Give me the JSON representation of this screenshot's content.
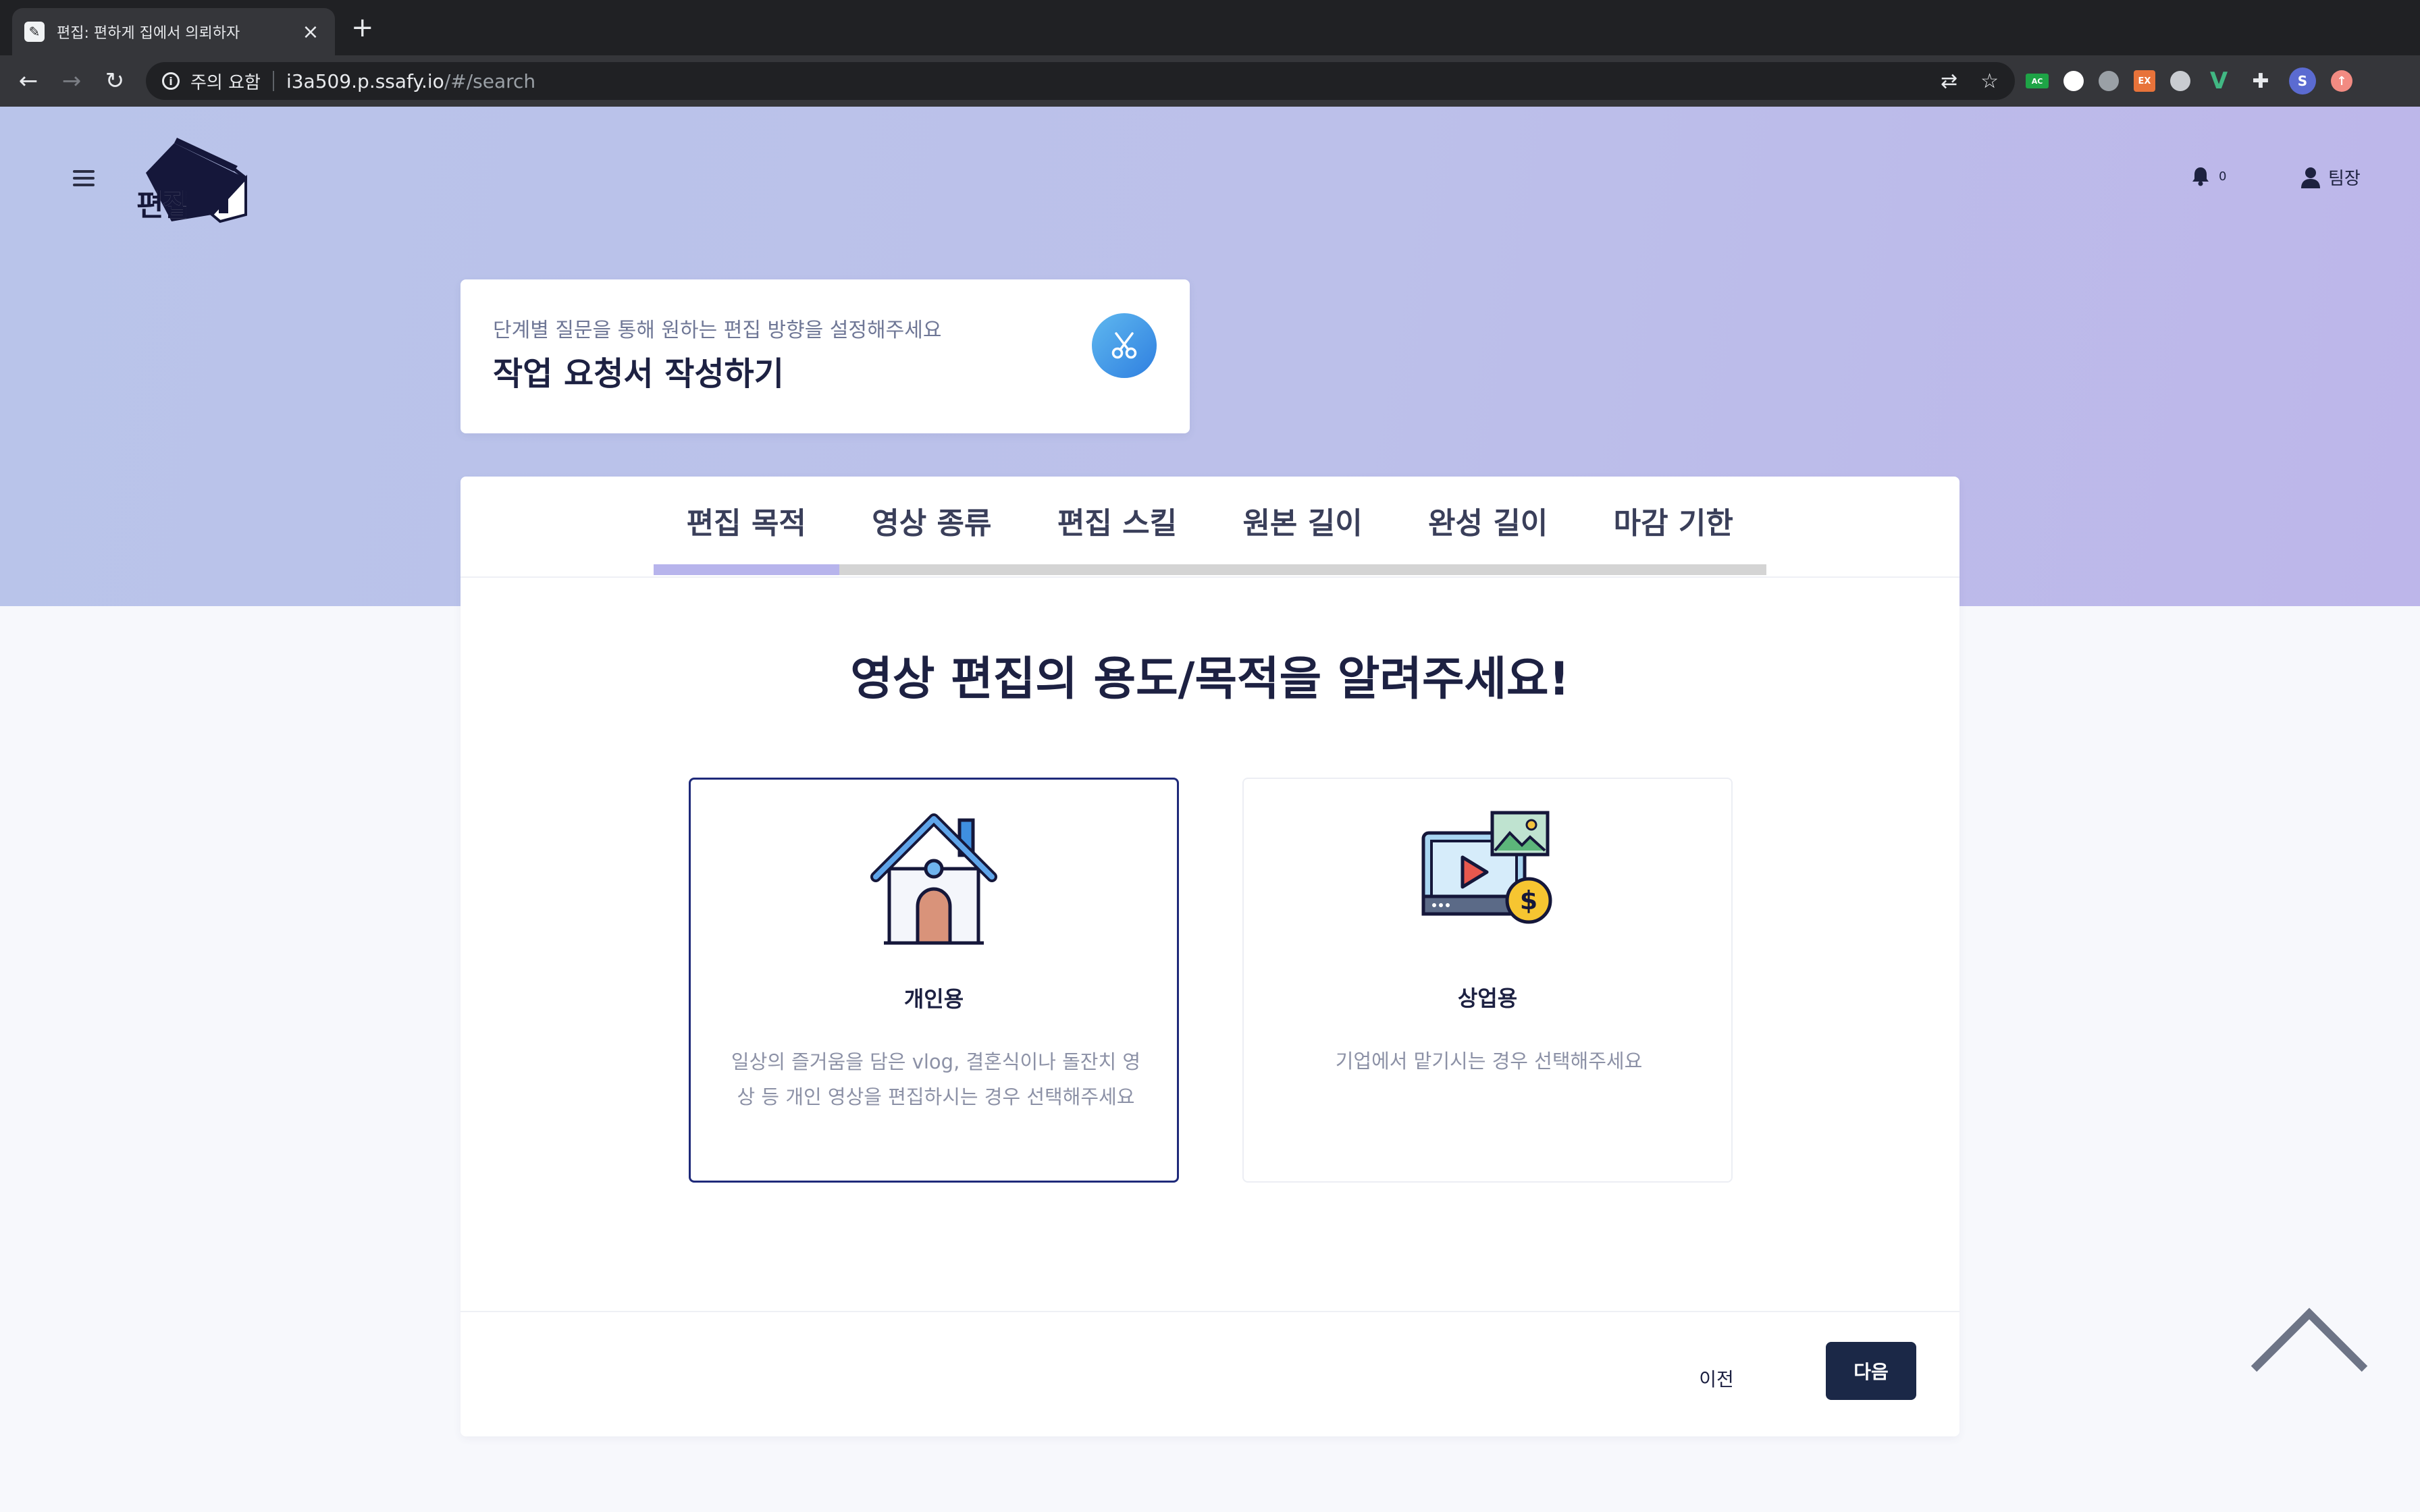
{
  "browser": {
    "tab_title": "편집: 편하게 집에서 의뢰하자",
    "security_text": "주의 요함",
    "url_host": "i3a509.p.ssafy.io",
    "url_path": "/#/search"
  },
  "nav": {
    "logo_text": "편집",
    "notification_count": "0",
    "user_name": "팀장"
  },
  "header_card": {
    "subtitle": "단계별 질문을 통해 원하는 편집 방향을 설정해주세요",
    "title": "작업 요청서 작성하기"
  },
  "steps": {
    "items": [
      {
        "label": "편집 목적"
      },
      {
        "label": "영상 종류"
      },
      {
        "label": "편집 스킬"
      },
      {
        "label": "원본 길이"
      },
      {
        "label": "완성 길이"
      },
      {
        "label": "마감 기한"
      }
    ],
    "current_step": 1,
    "progress_fraction": 0.1667
  },
  "question": "영상 편집의 용도/목적을 알려주세요!",
  "options": [
    {
      "title": "개인용",
      "description": "일상의 즐거움을 담은 vlog, 결혼식이나 돌잔치 영상 등 개인 영상을 편집하시는 경우 선택해주세요",
      "icon": "house-icon",
      "selected": true
    },
    {
      "title": "상업용",
      "description": "기업에서 맡기시는 경우 선택해주세요",
      "icon": "video-money-icon",
      "selected": false
    }
  ],
  "footer": {
    "prev_label": "이전",
    "next_label": "다음"
  },
  "colors": {
    "primary_dark": "#1b2847",
    "selected_border": "#1f2a7a",
    "progress_fill": "#b7b4ec",
    "hero_gradient_start": "#b9c4ea",
    "hero_gradient_end": "#bdb6ea"
  }
}
